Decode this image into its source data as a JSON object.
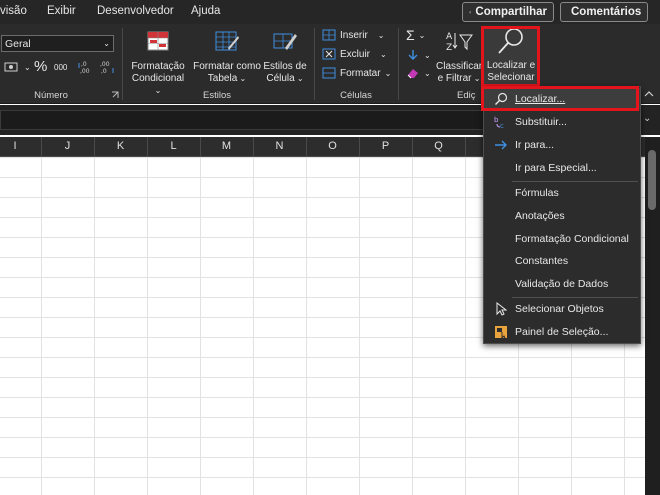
{
  "menubar": {
    "tabs": [
      "visão",
      "Exibir",
      "Desenvolvedor",
      "Ajuda"
    ],
    "share_label": "Compartilhar",
    "comments_label": "Comentários"
  },
  "ribbon": {
    "number_group": {
      "format_value": "Geral",
      "percent_symbol": "%",
      "thousands_symbol": "000",
      "label": "Número"
    },
    "styles_group": {
      "conditional_format_label": [
        "Formatação",
        "Condicional"
      ],
      "format_table_label": [
        "Formatar como",
        "Tabela"
      ],
      "cell_styles_label": [
        "Estilos de",
        "Célula"
      ],
      "label": "Estilos"
    },
    "cells_group": {
      "insert_label": "Inserir",
      "delete_label": "Excluir",
      "format_label": "Formatar",
      "label": "Células"
    },
    "editing_group": {
      "sort_filter_label": [
        "Classificar",
        "e Filtrar"
      ],
      "find_select_label": [
        "Localizar e",
        "Selecionar"
      ],
      "label": "Ediç"
    }
  },
  "columns": [
    "I",
    "J",
    "K",
    "L",
    "M",
    "N",
    "O",
    "P",
    "Q"
  ],
  "dropdown": {
    "items": [
      {
        "label": "Localizar...",
        "icon": "search-icon"
      },
      {
        "label": "Substituir...",
        "icon": "replace-icon"
      },
      {
        "label": "Ir para...",
        "icon": "arrow-right-icon"
      },
      {
        "label": "Ir para Especial...",
        "icon": ""
      },
      {
        "label": "Fórmulas",
        "icon": ""
      },
      {
        "label": "Anotações",
        "icon": ""
      },
      {
        "label": "Formatação Condicional",
        "icon": ""
      },
      {
        "label": "Constantes",
        "icon": ""
      },
      {
        "label": "Validação de Dados",
        "icon": ""
      },
      {
        "label": "Selecionar Objetos",
        "icon": "cursor-icon"
      },
      {
        "label": "Painel de Seleção...",
        "icon": "selection-pane-icon"
      }
    ]
  },
  "colors": {
    "highlight": "#e2141c",
    "ribbon_bg": "#2b2b2b",
    "accent_blue": "#3f8fe0"
  }
}
